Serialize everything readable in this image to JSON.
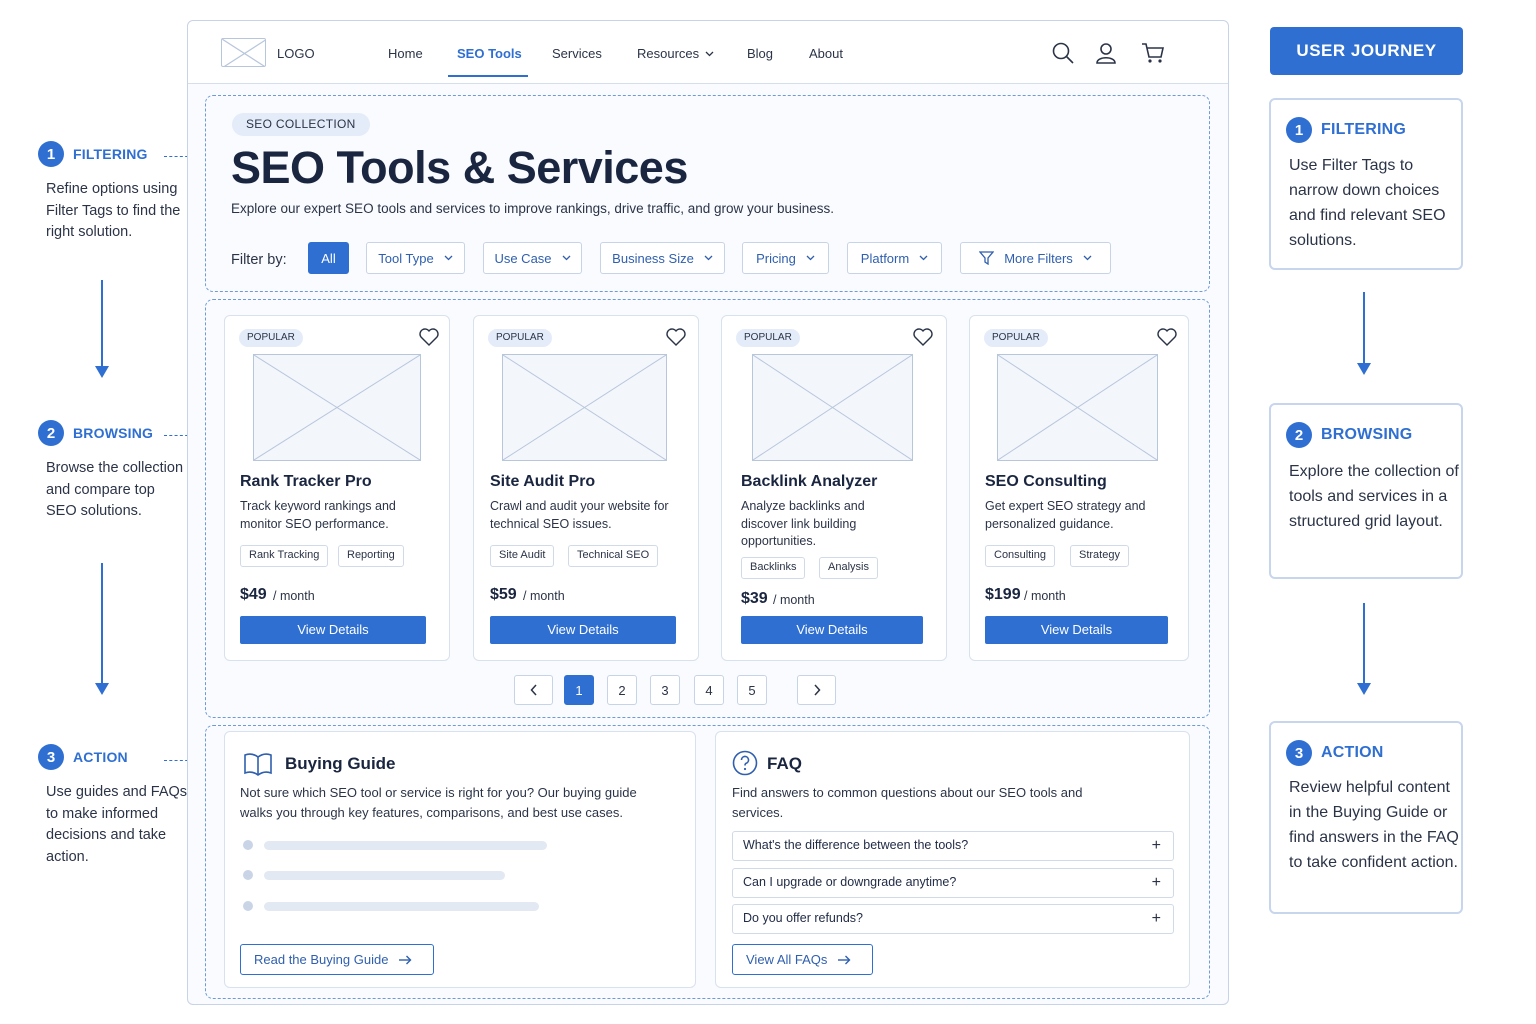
{
  "left_steps": [
    {
      "num": "1",
      "title": "FILTERING",
      "text": "Refine options using Filter Tags to find the right solution."
    },
    {
      "num": "2",
      "title": "BROWSING",
      "text": "Browse the collection and compare top SEO solutions."
    },
    {
      "num": "3",
      "title": "ACTION",
      "text": "Use guides and FAQs to make informed decisions and take action."
    }
  ],
  "nav": {
    "logo": "LOGO",
    "links": [
      "Home",
      "SEO Tools",
      "Services",
      "Resources",
      "Blog",
      "About"
    ],
    "active": "SEO Tools"
  },
  "hero": {
    "badge": "SEO COLLECTION",
    "title": "SEO Tools & Services",
    "subtitle": "Explore our expert SEO tools and services to improve rankings, drive traffic, and grow your business.",
    "filter_label": "Filter by:",
    "filters": [
      "All",
      "Tool Type",
      "Use Case",
      "Business Size",
      "Pricing",
      "Platform",
      "More Filters"
    ]
  },
  "cards": [
    {
      "badge": "POPULAR",
      "title": "Rank Tracker Pro",
      "desc": "Track keyword rankings and monitor SEO performance.",
      "tags": [
        "Rank Tracking",
        "Reporting"
      ],
      "price": "$49",
      "per": "/ month",
      "button": "View Details"
    },
    {
      "badge": "POPULAR",
      "title": "Site Audit Pro",
      "desc": "Crawl and audit your website for technical SEO issues.",
      "tags": [
        "Site Audit",
        "Technical SEO"
      ],
      "price": "$59",
      "per": "/ month",
      "button": "View Details"
    },
    {
      "badge": "POPULAR",
      "title": "Backlink Analyzer",
      "desc": "Analyze backlinks and discover link building opportunities.",
      "tags": [
        "Backlinks",
        "Analysis"
      ],
      "price": "$39",
      "per": "/ month",
      "button": "View Details"
    },
    {
      "badge": "POPULAR",
      "title": "SEO Consulting",
      "desc": "Get expert SEO strategy and personalized guidance.",
      "tags": [
        "Consulting",
        "Strategy"
      ],
      "price": "$199",
      "per": "/ month",
      "button": "View Details"
    }
  ],
  "pagination": {
    "pages": [
      "1",
      "2",
      "3",
      "4",
      "5"
    ],
    "current": "1"
  },
  "buying_guide": {
    "title": "Buying Guide",
    "text": "Not sure which SEO tool or service is right for you? Our buying guide walks you through key features, comparisons, and best use cases.",
    "button": "Read the Buying Guide"
  },
  "faq": {
    "title": "FAQ",
    "text": "Find answers to common questions about our SEO tools and services.",
    "questions": [
      "What's the difference between the tools?",
      "Can I upgrade or downgrade anytime?",
      "Do you offer refunds?"
    ],
    "button": "View All FAQs"
  },
  "journey": {
    "title": "USER JOURNEY",
    "steps": [
      {
        "num": "1",
        "title": "FILTERING",
        "text": "Use Filter Tags to narrow down choices and find relevant SEO solutions."
      },
      {
        "num": "2",
        "title": "BROWSING",
        "text": "Explore the collection of tools and services in a structured grid layout."
      },
      {
        "num": "3",
        "title": "ACTION",
        "text": "Review helpful content in the Buying Guide or find answers in the FAQ to take confident action."
      }
    ]
  },
  "colors": {
    "accent": "#2f6fd1",
    "border": "#c7d3e6",
    "text": "#1f2a44"
  }
}
